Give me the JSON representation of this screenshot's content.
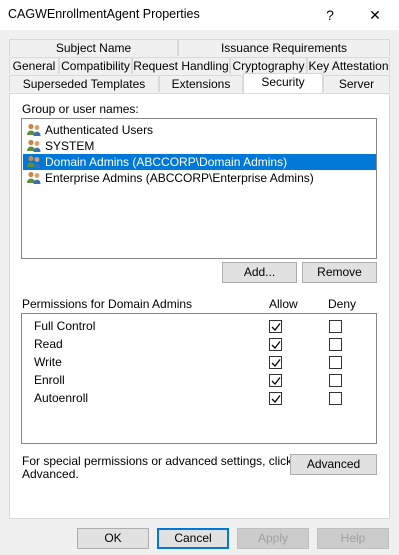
{
  "window": {
    "title": "CAGWEnrollmentAgent Properties",
    "help_glyph": "?",
    "close_glyph": "✕"
  },
  "tabs": {
    "row1": [
      "Subject Name",
      "Issuance Requirements"
    ],
    "row2": [
      "General",
      "Compatibility",
      "Request Handling",
      "Cryptography",
      "Key Attestation"
    ],
    "row3": [
      "Superseded Templates",
      "Extensions",
      "Security",
      "Server"
    ],
    "active": "Security"
  },
  "security": {
    "group_label": "Group or user names:",
    "users": [
      {
        "name": "Authenticated Users",
        "icon": "users-icon",
        "selected": false
      },
      {
        "name": "SYSTEM",
        "icon": "users-icon",
        "selected": false
      },
      {
        "name": "Domain Admins (ABCCORP\\Domain Admins)",
        "icon": "users-icon",
        "selected": true
      },
      {
        "name": "Enterprise Admins (ABCCORP\\Enterprise Admins)",
        "icon": "users-icon",
        "selected": false
      }
    ],
    "add_label": "Add...",
    "remove_label": "Remove",
    "permissions_label": "Permissions for Domain Admins",
    "allow_header": "Allow",
    "deny_header": "Deny",
    "permissions": [
      {
        "name": "Full Control",
        "allow": true,
        "deny": false
      },
      {
        "name": "Read",
        "allow": true,
        "deny": false
      },
      {
        "name": "Write",
        "allow": true,
        "deny": false
      },
      {
        "name": "Enroll",
        "allow": true,
        "deny": false
      },
      {
        "name": "Autoenroll",
        "allow": true,
        "deny": false
      }
    ],
    "advanced_text_line1": "For special permissions or advanced settings, click",
    "advanced_text_line2": "Advanced.",
    "advanced_label": "Advanced"
  },
  "footer": {
    "ok": "OK",
    "cancel": "Cancel",
    "apply": "Apply",
    "help": "Help"
  },
  "colors": {
    "selection": "#0078d7",
    "window_bg": "#f0f0f0"
  }
}
